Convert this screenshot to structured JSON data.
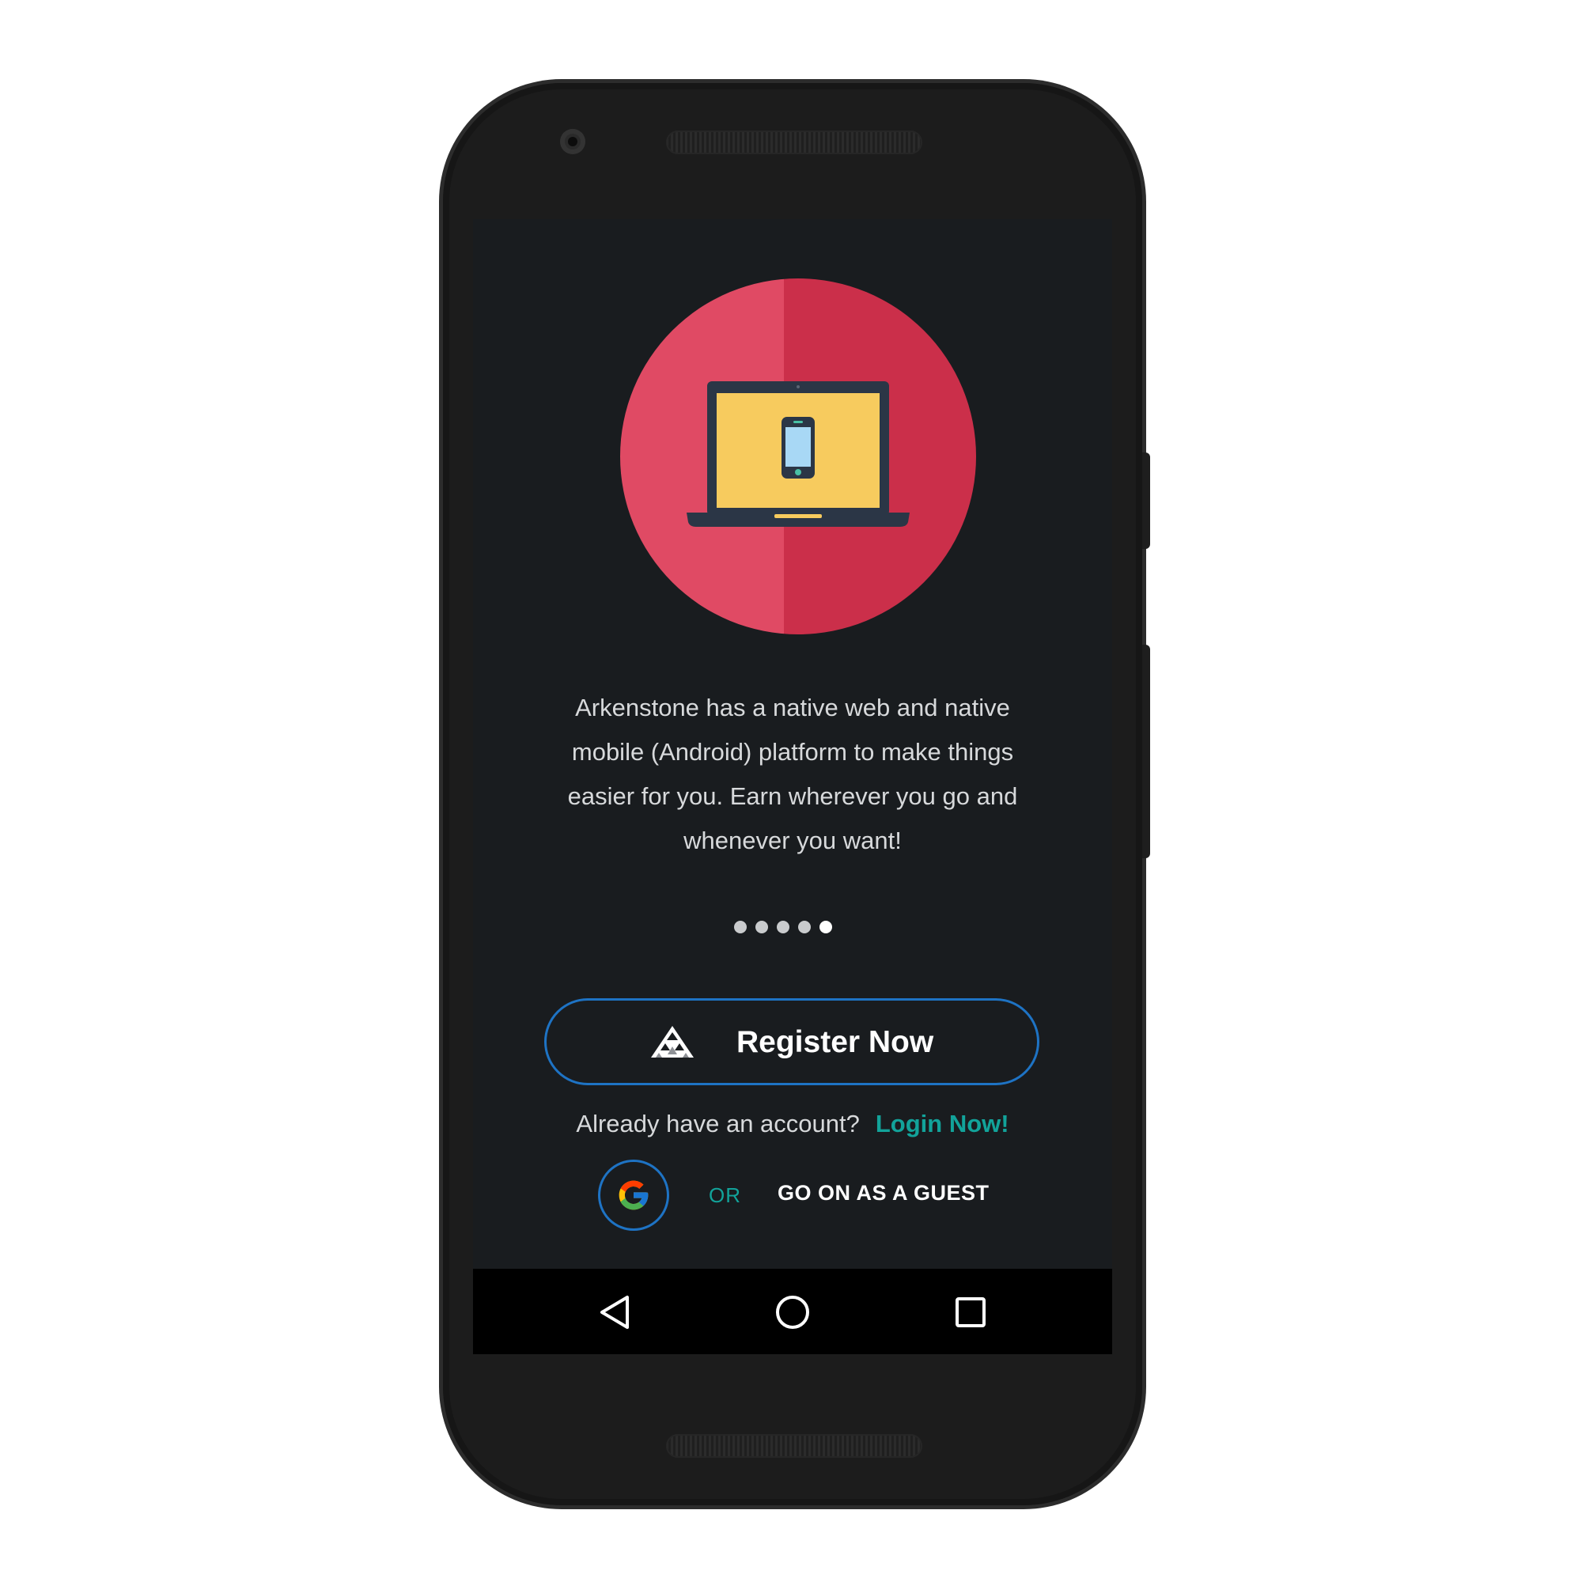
{
  "onboarding": {
    "description": "Arkenstone has a native web and native mobile (Android) platform to make things easier for you. Earn wherever you go and whenever you want!",
    "illustration_icon": "laptop-with-phone-icon",
    "page_count": 5,
    "current_page": 5
  },
  "register": {
    "label": "Register Now",
    "icon": "arkenstone-mountain-logo-icon"
  },
  "login": {
    "prompt": "Already have an account?",
    "link_label": "Login Now!"
  },
  "alternatives": {
    "google_icon": "google-icon",
    "or_label": "OR",
    "guest_label": "GO ON AS A GUEST"
  },
  "navbar": {
    "back_icon": "back-triangle-icon",
    "home_icon": "home-circle-icon",
    "recents_icon": "recents-square-icon"
  },
  "colors": {
    "background": "#191c1f",
    "hero_left": "#e04a64",
    "hero_right": "#cb2f4a",
    "laptop_screen": "#f7cb5e",
    "button_border": "#1e73c4",
    "accent_teal": "#12a39a"
  }
}
